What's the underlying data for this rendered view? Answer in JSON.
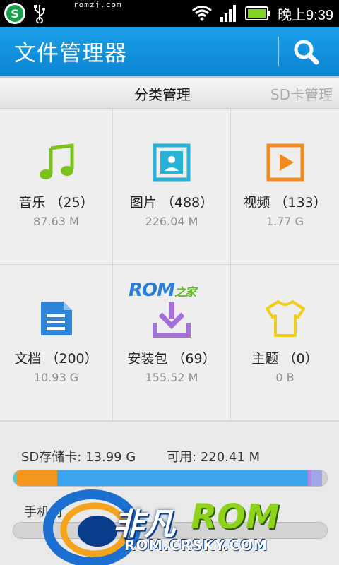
{
  "status_bar": {
    "domain": "romzj.com",
    "time": "晚上9:39",
    "icons": [
      "app-logo-icon",
      "usb-icon",
      "wifi-icon",
      "signal-icon",
      "battery-icon"
    ]
  },
  "title_bar": {
    "title": "文件管理器",
    "search_icon": "search-icon",
    "color": "#1a95e0"
  },
  "tabs": {
    "active": "分类管理",
    "next": "SD卡管理"
  },
  "categories": [
    {
      "label": "音乐 （25）",
      "size": "87.63 M",
      "icon": "music-note-icon",
      "color": "#7cc21f"
    },
    {
      "label": "图片 （488）",
      "size": "226.04 M",
      "icon": "picture-icon",
      "color": "#27b3d8"
    },
    {
      "label": "视频 （133）",
      "size": "1.77 G",
      "icon": "video-play-icon",
      "color": "#f08a1c"
    },
    {
      "label": "文档 （200）",
      "size": "10.93 G",
      "icon": "document-icon",
      "color": "#2f86d8"
    },
    {
      "label": "安装包 （69）",
      "size": "155.52 M",
      "icon": "download-install-icon",
      "color": "#a56fd8"
    },
    {
      "label": "主题 （0）",
      "size": "0 B",
      "icon": "tshirt-icon",
      "color": "#f2cc1a"
    }
  ],
  "storage": {
    "sd_label": "SD存储卡: 13.99 G",
    "available": "可用: 220.41 M",
    "segments": [
      {
        "name": "music",
        "fraction": 0.012,
        "color": "#3fd0d8"
      },
      {
        "name": "video",
        "fraction": 0.128,
        "color": "#f5951c"
      },
      {
        "name": "document",
        "fraction": 0.8,
        "color": "#3aa6f0"
      },
      {
        "name": "install",
        "fraction": 0.01,
        "color": "#b488e0"
      },
      {
        "name": "other",
        "fraction": 0.035,
        "color": "#9ea6e6"
      },
      {
        "name": "free",
        "fraction": 0.015,
        "color": "#d0d0d0"
      }
    ],
    "phone_label": "手机内"
  },
  "watermarks": {
    "rom_top": "ROM",
    "rom_top_suffix": "之家",
    "brand_cn": "非凡",
    "brand_rom": "ROM",
    "url": "ROM.CRSKY.COM"
  }
}
